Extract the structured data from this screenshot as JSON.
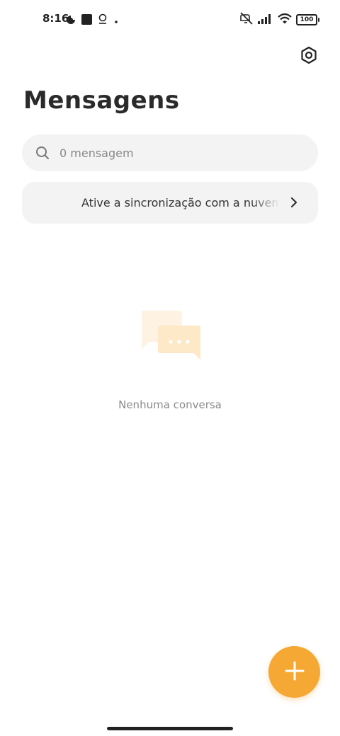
{
  "status_bar": {
    "time": "8:16",
    "battery": "100",
    "icons": [
      "data-saver-icon",
      "square-notification-icon",
      "location-pin-icon",
      "dot-icon",
      "mute-vibrate-icon",
      "signal-icon",
      "wifi-icon",
      "battery-icon"
    ]
  },
  "header": {
    "title": "Mensagens",
    "settings_icon": "settings-hexagon-icon"
  },
  "search": {
    "placeholder": "0 mensagem",
    "value": ""
  },
  "sync_banner": {
    "text": "Ative a sincronização com a nuvem para",
    "chevron_icon": "chevron-right-icon"
  },
  "empty_state": {
    "illustration": "chat-bubbles-icon",
    "text": "Nenhuma conversa"
  },
  "fab": {
    "icon": "plus-icon",
    "color": "#f5a833"
  },
  "colors": {
    "accent": "#f5a833",
    "surface": "#f3f3f3",
    "illustration": "#fde8c8"
  }
}
